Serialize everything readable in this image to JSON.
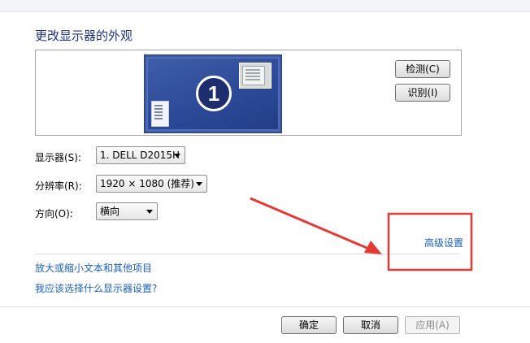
{
  "title": "更改显示器的外观",
  "preview": {
    "monitor_number": "1"
  },
  "buttons": {
    "detect": "检测(C)",
    "identify": "识别(I)",
    "ok": "确定",
    "cancel": "取消",
    "apply": "应用(A)"
  },
  "fields": {
    "display_label": "显示器(S):",
    "display_value": "1. DELL D2015H",
    "resolution_label": "分辨率(R):",
    "resolution_value": "1920 × 1080 (推荐)",
    "orientation_label": "方向(O):",
    "orientation_value": "横向"
  },
  "links": {
    "advanced": "高级设置",
    "text_size": "放大或缩小文本和其他项目",
    "which_settings": "我应该选择什么显示器设置?"
  },
  "colors": {
    "link": "#1a5fc5",
    "title": "#1e3287",
    "annotation": "#e53935"
  }
}
